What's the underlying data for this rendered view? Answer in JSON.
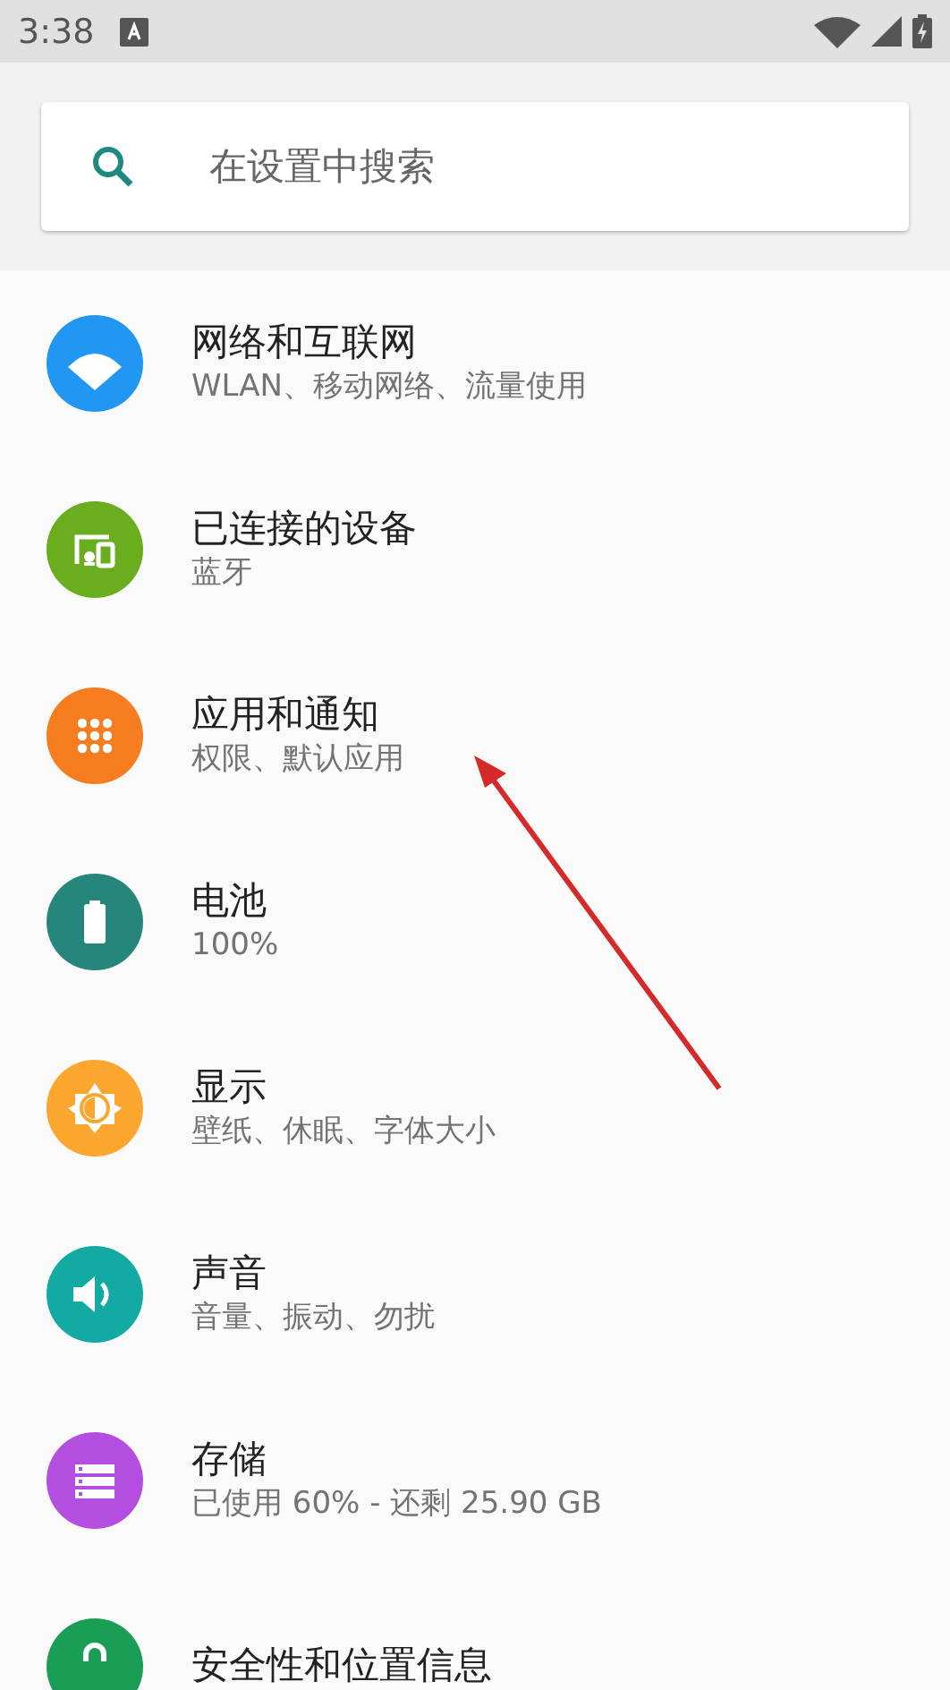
{
  "status_bar": {
    "time": "3:38"
  },
  "search": {
    "placeholder": "在设置中搜索"
  },
  "items": [
    {
      "kind": "network",
      "color": "#2196f3",
      "title": "网络和互联网",
      "subtitle": "WLAN、移动网络、流量使用"
    },
    {
      "kind": "devices",
      "color": "#6aad1e",
      "title": "已连接的设备",
      "subtitle": "蓝牙"
    },
    {
      "kind": "apps",
      "color": "#f57c1f",
      "title": "应用和通知",
      "subtitle": "权限、默认应用"
    },
    {
      "kind": "battery",
      "color": "#26867b",
      "title": "电池",
      "subtitle": "100%"
    },
    {
      "kind": "display",
      "color": "#fba62f",
      "title": "显示",
      "subtitle": "壁纸、休眠、字体大小"
    },
    {
      "kind": "sound",
      "color": "#12aaa3",
      "title": "声音",
      "subtitle": "音量、振动、勿扰"
    },
    {
      "kind": "storage",
      "color": "#b44ee0",
      "title": "存储",
      "subtitle": "已使用 60% - 还剩 25.90 GB"
    },
    {
      "kind": "security",
      "color": "#1a9e55",
      "title": "安全性和位置信息"
    }
  ]
}
